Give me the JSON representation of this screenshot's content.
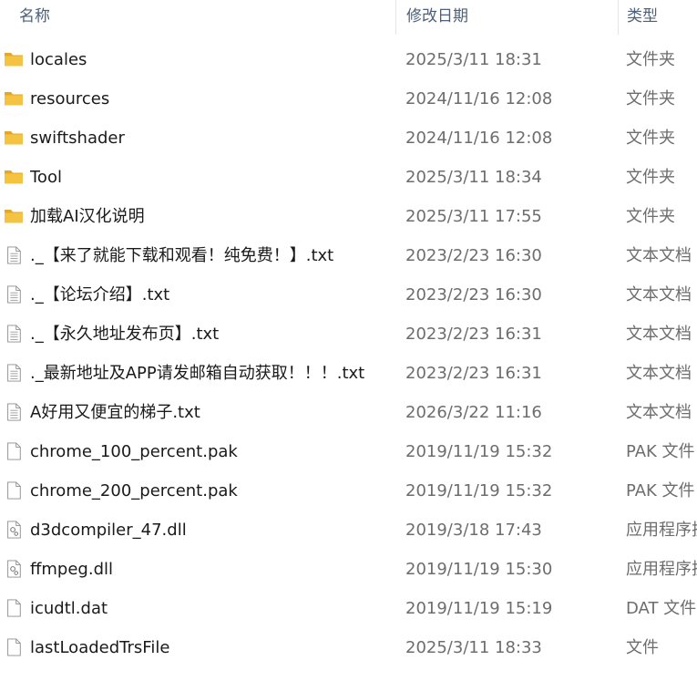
{
  "header": {
    "name_label": "名称",
    "date_label": "修改日期",
    "type_label": "类型",
    "sort_glyph": "^"
  },
  "colors": {
    "folder": "#f5c342",
    "folder_tab": "#e3a82b",
    "header_text": "#4c607a",
    "detail_text": "#6d6d6d"
  },
  "files": [
    {
      "name": "locales",
      "date": "2025/3/11 18:31",
      "type": "文件夹",
      "icon": "folder-icon"
    },
    {
      "name": "resources",
      "date": "2024/11/16 12:08",
      "type": "文件夹",
      "icon": "folder-icon"
    },
    {
      "name": "swiftshader",
      "date": "2024/11/16 12:08",
      "type": "文件夹",
      "icon": "folder-icon"
    },
    {
      "name": "Tool",
      "date": "2025/3/11 18:34",
      "type": "文件夹",
      "icon": "folder-icon"
    },
    {
      "name": "加载AI汉化说明",
      "date": "2025/3/11 17:55",
      "type": "文件夹",
      "icon": "folder-icon"
    },
    {
      "name": "._【来了就能下载和观看！纯免费！】.txt",
      "date": "2023/2/23 16:30",
      "type": "文本文档",
      "icon": "text-file-icon"
    },
    {
      "name": "._【论坛介绍】.txt",
      "date": "2023/2/23 16:30",
      "type": "文本文档",
      "icon": "text-file-icon"
    },
    {
      "name": "._【永久地址发布页】.txt",
      "date": "2023/2/23 16:31",
      "type": "文本文档",
      "icon": "text-file-icon"
    },
    {
      "name": "._最新地址及APP请发邮箱自动获取！！！.txt",
      "date": "2023/2/23 16:31",
      "type": "文本文档",
      "icon": "text-file-icon"
    },
    {
      "name": "A好用又便宜的梯子.txt",
      "date": "2026/3/22 11:16",
      "type": "文本文档",
      "icon": "text-file-icon"
    },
    {
      "name": "chrome_100_percent.pak",
      "date": "2019/11/19 15:32",
      "type": "PAK 文件",
      "icon": "file-icon"
    },
    {
      "name": "chrome_200_percent.pak",
      "date": "2019/11/19 15:32",
      "type": "PAK 文件",
      "icon": "file-icon"
    },
    {
      "name": "d3dcompiler_47.dll",
      "date": "2019/3/18 17:43",
      "type": "应用程序扩",
      "icon": "dll-file-icon"
    },
    {
      "name": "ffmpeg.dll",
      "date": "2019/11/19 15:30",
      "type": "应用程序扩",
      "icon": "dll-file-icon"
    },
    {
      "name": "icudtl.dat",
      "date": "2019/11/19 15:19",
      "type": "DAT 文件",
      "icon": "file-icon"
    },
    {
      "name": "lastLoadedTrsFile",
      "date": "2025/3/11 18:33",
      "type": "文件",
      "icon": "file-icon"
    }
  ]
}
